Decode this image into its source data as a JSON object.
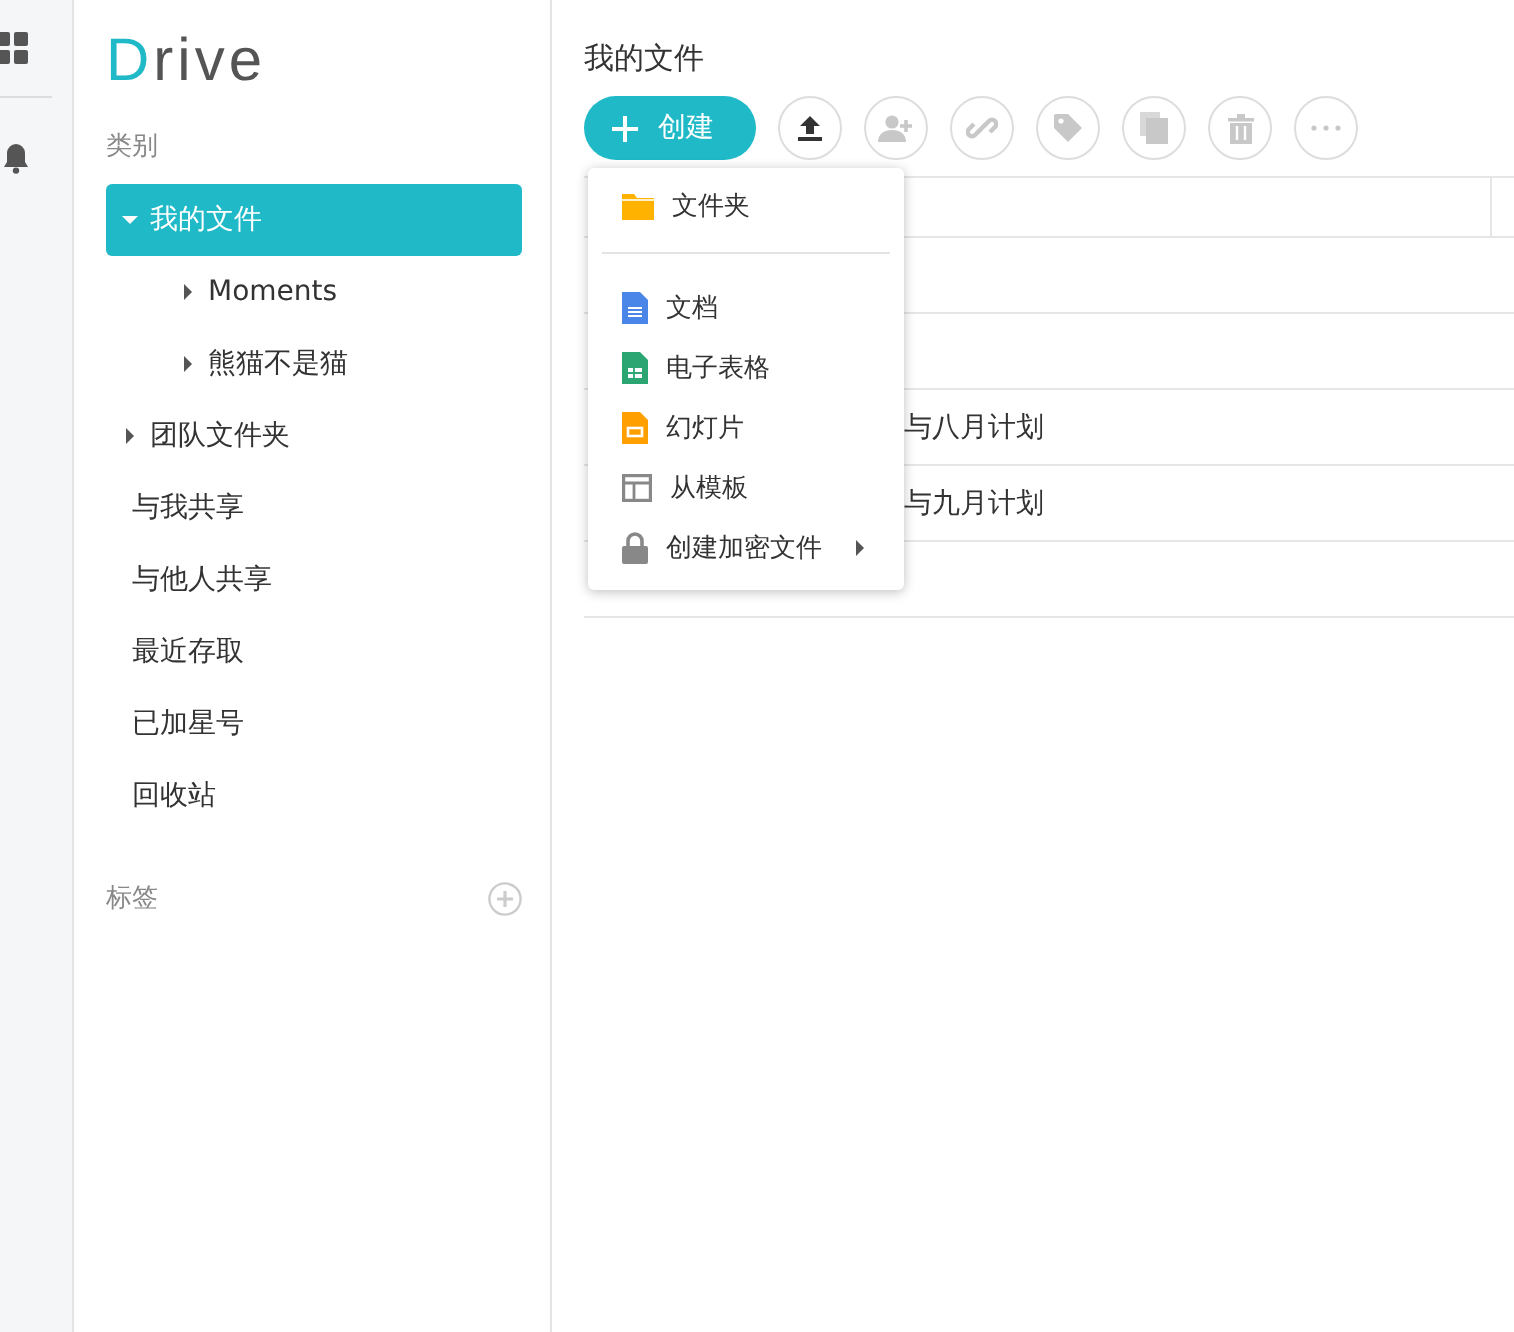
{
  "logo": "Drive",
  "sidebar": {
    "section_label": "类别",
    "items": [
      {
        "label": "我的文件",
        "selected": true,
        "expanded": true,
        "children": [
          {
            "label": "Moments",
            "selected": false
          },
          {
            "label": "熊猫不是猫",
            "selected": false
          }
        ]
      },
      {
        "label": "团队文件夹",
        "selected": false,
        "expanded": false
      },
      {
        "label": "与我共享",
        "selected": false
      },
      {
        "label": "与他人共享",
        "selected": false
      },
      {
        "label": "最近存取",
        "selected": false
      },
      {
        "label": "已加星号",
        "selected": false
      },
      {
        "label": "回收站",
        "selected": false
      }
    ],
    "tags_label": "标签"
  },
  "main": {
    "title": "我的文件",
    "create_button": "创建",
    "toolbar": [
      {
        "kind": "upload",
        "disabled": false
      },
      {
        "kind": "share",
        "disabled": true
      },
      {
        "kind": "link",
        "disabled": true
      },
      {
        "kind": "tag",
        "disabled": true
      },
      {
        "kind": "copy",
        "disabled": true
      },
      {
        "kind": "delete",
        "disabled": true
      },
      {
        "kind": "more",
        "disabled": true
      }
    ],
    "rows": [
      {
        "name": ""
      },
      {
        "name": ""
      },
      {
        "name": "与八月计划"
      },
      {
        "name": "与九月计划"
      },
      {
        "name": ""
      }
    ]
  },
  "create_menu": [
    {
      "kind": "folder",
      "label": "文件夹"
    },
    {
      "kind": "divider"
    },
    {
      "kind": "doc",
      "label": "文档"
    },
    {
      "kind": "sheet",
      "label": "电子表格"
    },
    {
      "kind": "slides",
      "label": "幻灯片"
    },
    {
      "kind": "template",
      "label": "从模板"
    },
    {
      "kind": "locked",
      "label": "创建加密文件",
      "submenu": true
    }
  ]
}
